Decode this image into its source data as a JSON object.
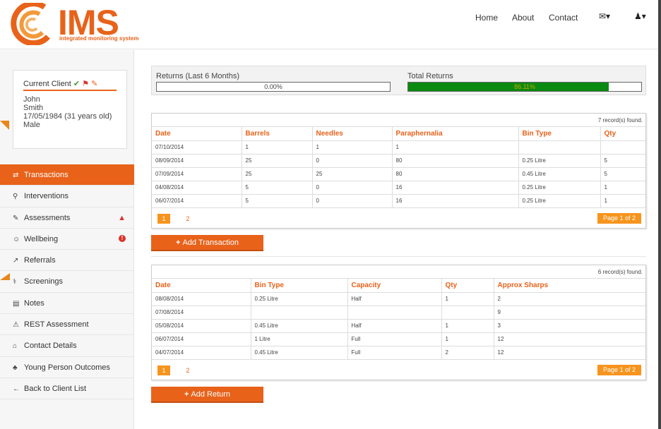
{
  "logo": {
    "text": "IMS",
    "subtitle": "integrated monitoring system"
  },
  "nav": {
    "home": "Home",
    "about": "About",
    "contact": "Contact",
    "mail_icon": "envelope-icon",
    "user_icon": "user-icon"
  },
  "client": {
    "title": "Current Client",
    "first_name": "John",
    "last_name": "Smith",
    "dob": "17/05/1984 (31 years old)",
    "gender": "Male"
  },
  "menu": [
    {
      "label": "Transactions",
      "icon": "⇄",
      "active": true
    },
    {
      "label": "Interventions",
      "icon": "⚲"
    },
    {
      "label": "Assessments",
      "icon": "✎"
    },
    {
      "label": "Wellbeing",
      "icon": "☺"
    },
    {
      "label": "Referrals",
      "icon": "↗"
    },
    {
      "label": "Screenings",
      "icon": "⚕"
    },
    {
      "label": "Notes",
      "icon": "▤"
    },
    {
      "label": "REST Assessment",
      "icon": "⚠"
    },
    {
      "label": "Contact Details",
      "icon": "⌂"
    },
    {
      "label": "Young Person Outcomes",
      "icon": "♣"
    },
    {
      "label": "Back to Client List",
      "icon": "←"
    }
  ],
  "returns": {
    "last6_label": "Returns (Last 6 Months)",
    "last6_value": "0.00%",
    "total_label": "Total Returns",
    "total_value": "86.11%",
    "total_fraction": 0.8611,
    "fill_color": "#0a8a10"
  },
  "transactions": {
    "records": "7 record(s) found.",
    "columns": [
      "Date",
      "Barrels",
      "Needles",
      "Paraphernalia",
      "Bin Type",
      "Qty"
    ],
    "rows": [
      [
        "07/10/2014",
        "1",
        "1",
        "1",
        "",
        ""
      ],
      [
        "08/09/2014",
        "25",
        "0",
        "80",
        "0.25 Litre",
        "5"
      ],
      [
        "07/09/2014",
        "25",
        "25",
        "80",
        "0.45 Litre",
        "5"
      ],
      [
        "04/08/2014",
        "5",
        "0",
        "16",
        "0.25 Litre",
        "1"
      ],
      [
        "06/07/2014",
        "5",
        "0",
        "16",
        "0.25 Litre",
        "1"
      ]
    ],
    "pages": [
      "1",
      "2"
    ],
    "page_info": "Page 1 of 2",
    "button": "Add Transaction"
  },
  "returns_table": {
    "records": "6 record(s) found.",
    "columns": [
      "Date",
      "Bin Type",
      "Capacity",
      "Qty",
      "Approx Sharps"
    ],
    "rows": [
      [
        "08/08/2014",
        "0.25 Litre",
        "Half",
        "1",
        "2"
      ],
      [
        "07/08/2014",
        "",
        "",
        "",
        "9"
      ],
      [
        "05/08/2014",
        "0.45 Litre",
        "Half",
        "1",
        "3"
      ],
      [
        "06/07/2014",
        "1 Litre",
        "Full",
        "1",
        "12"
      ],
      [
        "04/07/2014",
        "0.45 Litre",
        "Full",
        "2",
        "12"
      ]
    ],
    "pages": [
      "1",
      "2"
    ],
    "page_info": "Page 1 of 2",
    "button": "Add Return"
  },
  "colors": {
    "accent": "#e8621a",
    "pager": "#f7941d",
    "success": "#0a8a10",
    "danger": "#d9332a"
  }
}
